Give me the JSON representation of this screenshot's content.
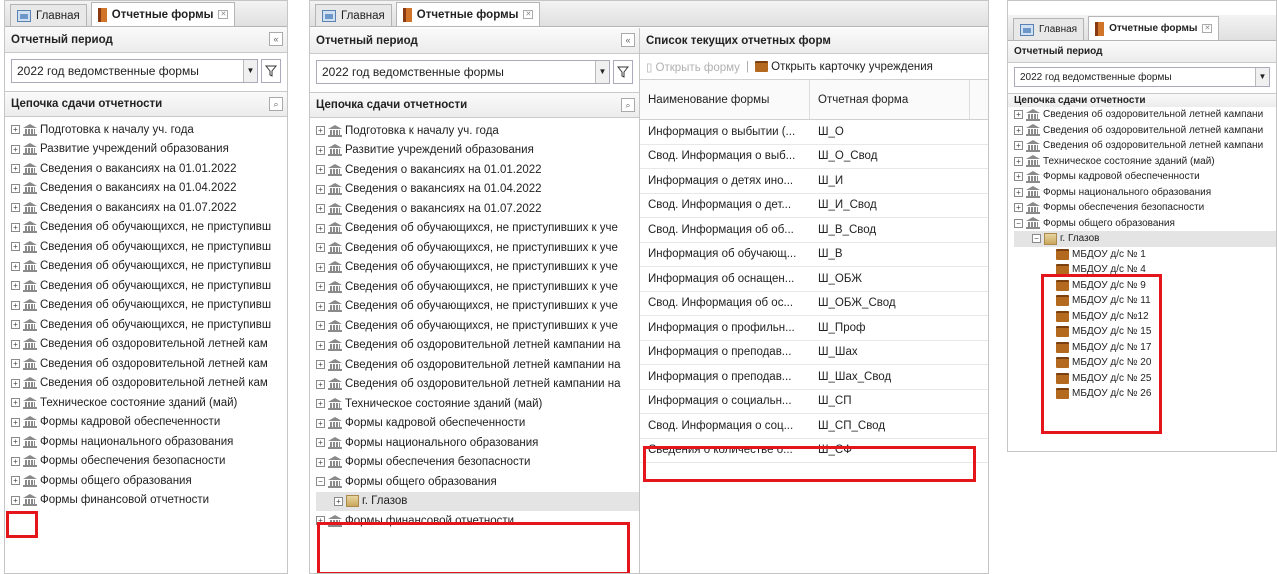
{
  "tabs": {
    "home": "Главная",
    "forms": "Отчетные формы"
  },
  "period": {
    "title": "Отчетный период",
    "value": "2022 год ведомственные формы"
  },
  "chain": {
    "title": "Цепочка сдачи отчетности"
  },
  "panel1": {
    "items": [
      "Подготовка к началу уч. года",
      "Развитие учреждений образования",
      "Сведения о вакансиях на 01.01.2022",
      "Сведения о вакансиях на 01.04.2022",
      "Сведения о вакансиях на 01.07.2022",
      "Сведения об обучающихся, не приступивш",
      "Сведения об обучающихся, не приступивш",
      "Сведения об обучающихся, не приступивш",
      "Сведения об обучающихся, не приступивш",
      "Сведения об обучающихся, не приступивш",
      "Сведения об обучающихся, не приступивш",
      "Сведения об оздоровительной летней кам",
      "Сведения об оздоровительной летней кам",
      "Сведения об оздоровительной летней кам",
      "Техническое состояние зданий (май)",
      "Формы кадровой обеспеченности",
      "Формы национального образования",
      "Формы обеспечения безопасности",
      "Формы общего образования",
      "Формы финансовой отчетности"
    ]
  },
  "panel2": {
    "items": [
      "Подготовка к началу уч. года",
      "Развитие учреждений образования",
      "Сведения о вакансиях на 01.01.2022",
      "Сведения о вакансиях на 01.04.2022",
      "Сведения о вакансиях на 01.07.2022",
      "Сведения об обучающихся, не приступивших к уче",
      "Сведения об обучающихся, не приступивших к уче",
      "Сведения об обучающихся, не приступивших к уче",
      "Сведения об обучающихся, не приступивших к уче",
      "Сведения об обучающихся, не приступивших к уче",
      "Сведения об обучающихся, не приступивших к уче",
      "Сведения об оздоровительной летней кампании на",
      "Сведения об оздоровительной летней кампании на",
      "Сведения об оздоровительной летней кампании на",
      "Техническое состояние зданий (май)",
      "Формы кадровой обеспеченности",
      "Формы национального образования",
      "Формы обеспечения безопасности",
      "Формы общего образования"
    ],
    "child": "г. Глазов",
    "last": "Формы финансовой отчетности"
  },
  "forms": {
    "title": "Список текущих отчетных форм",
    "open_btn": "Открыть форму",
    "card_btn": "Открыть карточку учреждения",
    "col_name": "Наименование формы",
    "col_form": "Отчетная форма",
    "rows": [
      {
        "name": "Информация о выбытии (...",
        "code": "Ш_О"
      },
      {
        "name": "Свод. Информация о выб...",
        "code": "Ш_О_Свод"
      },
      {
        "name": "Информация о детях ино...",
        "code": "Ш_И"
      },
      {
        "name": "Свод. Информация о дет...",
        "code": "Ш_И_Свод"
      },
      {
        "name": "Свод. Информация об об...",
        "code": "Ш_В_Свод"
      },
      {
        "name": "Информация об обучающ...",
        "code": "Ш_В"
      },
      {
        "name": "Информация об оснащен...",
        "code": "Ш_ОБЖ"
      },
      {
        "name": "Свод. Информация об ос...",
        "code": "Ш_ОБЖ_Свод"
      },
      {
        "name": "Информация о профильн...",
        "code": "Ш_Проф"
      },
      {
        "name": "Информация о преподав...",
        "code": "Ш_Шах"
      },
      {
        "name": "Информация о преподав...",
        "code": "Ш_Шах_Свод"
      },
      {
        "name": "Информация о социальн...",
        "code": "Ш_СП"
      },
      {
        "name": "Свод. Информация о соц...",
        "code": "Ш_СП_Свод"
      },
      {
        "name": "Сведения о количестве о...",
        "code": "Ш_СФ"
      }
    ]
  },
  "panel3": {
    "items": [
      "Сведения об оздоровительной летней кампани",
      "Сведения об оздоровительной летней кампани",
      "Сведения об оздоровительной летней кампани",
      "Техническое состояние зданий (май)",
      "Формы кадровой обеспеченности",
      "Формы национального образования",
      "Формы обеспечения безопасности",
      "Формы общего образования"
    ],
    "child": "г. Глазов",
    "schools": [
      "МБДОУ д/с № 1",
      "МБДОУ д/с № 4",
      "МБДОУ д/с № 9",
      "МБДОУ д/с № 11",
      "МБДОУ д/с №12",
      "МБДОУ д/с № 15",
      "МБДОУ д/с № 17",
      "МБДОУ д/с № 20",
      "МБДОУ д/с № 25",
      "МБДОУ д/с № 26"
    ]
  }
}
